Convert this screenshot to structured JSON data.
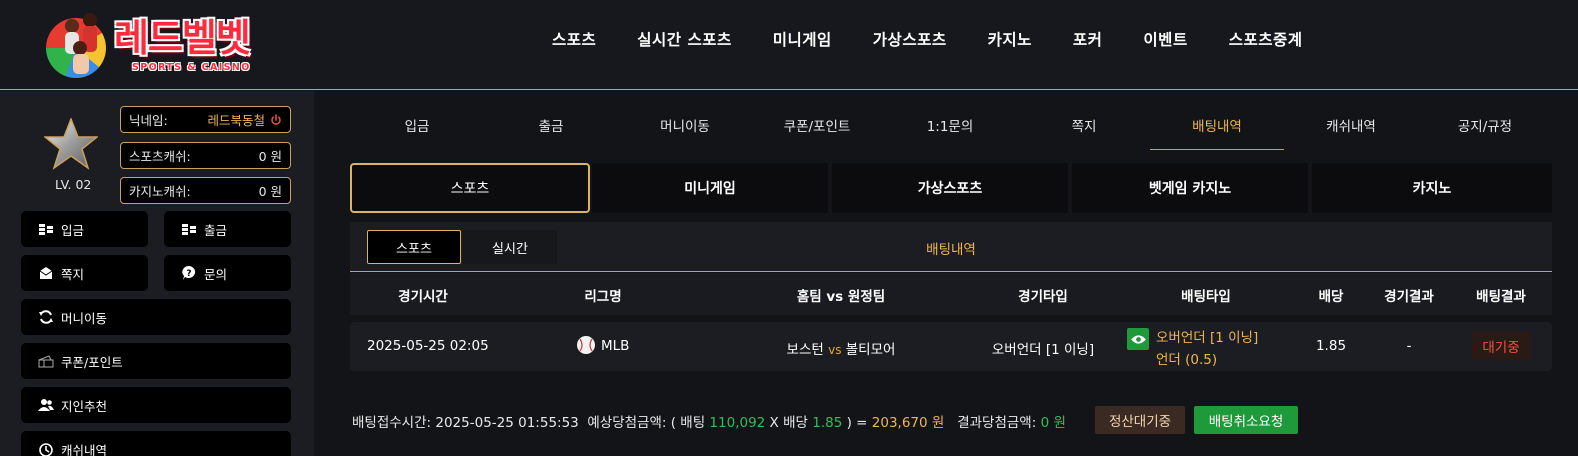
{
  "brand": {
    "name": "레드벨벳",
    "tagline": "SPORTS & CAISNO"
  },
  "topnav": [
    "스포츠",
    "실시간 스포츠",
    "미니게임",
    "가상스포츠",
    "카지노",
    "포커",
    "이벤트",
    "스포츠중계"
  ],
  "sidebar": {
    "level": "LV. 02",
    "nickname_label": "닉네임:",
    "nickname_value": "레드북동철",
    "sports_cash_label": "스포츠캐쉬:",
    "sports_cash_value": "0 원",
    "casino_cash_label": "카지노캐쉬:",
    "casino_cash_value": "0 원",
    "buttons": {
      "deposit": "입금",
      "withdraw": "출금",
      "message": "쪽지",
      "inquiry": "문의",
      "money_move": "머니이동",
      "coupon": "쿠폰/포인트",
      "referral": "지인추천",
      "cash_history": "캐쉬내역"
    }
  },
  "subnav": {
    "items": [
      "입금",
      "출금",
      "머니이동",
      "쿠폰/포인트",
      "1:1문의",
      "쪽지",
      "배팅내역",
      "캐쉬내역",
      "공지/규정"
    ],
    "active": "배팅내역"
  },
  "game_tabs": {
    "items": [
      "스포츠",
      "미니게임",
      "가상스포츠",
      "벳게임 카지노",
      "카지노"
    ],
    "active": "스포츠"
  },
  "inner_tabs": {
    "items": [
      "스포츠",
      "실시간"
    ],
    "active": "스포츠",
    "title": "배팅내역"
  },
  "table": {
    "headers": [
      "경기시간",
      "리그명",
      "홈팀 vs 원정팀",
      "경기타입",
      "배팅타입",
      "배당",
      "경기결과",
      "배팅결과"
    ],
    "rows": [
      {
        "time": "2025-05-25 02:05",
        "league": "MLB",
        "home": "보스턴",
        "vs": "vs",
        "away": "볼티모어",
        "game_type": "오버언더 [1 이닝]",
        "bet_type_line1": "오버언더 [1 이닝]",
        "bet_type_line2": "언더 (0.5)",
        "odds": "1.85",
        "game_result": "-",
        "bet_result": "대기중"
      }
    ]
  },
  "footer": {
    "received_label": "배팅접수시간:",
    "received_value": "2025-05-25 01:55:53",
    "expected_label": "예상당첨금액: ( 배팅",
    "bet_amount": "110,092",
    "x_label": "X 배당",
    "odds": "1.85",
    "equals": ") =",
    "expected_value": "203,670",
    "won_unit": "원",
    "result_label": "결과당첨금액:",
    "result_value": "0",
    "result_unit": "원",
    "settle_button": "정산대기중",
    "cancel_button": "배팅취소요청"
  },
  "colors": {
    "gold": "#c9a15c",
    "accent_text": "#f0b54f",
    "green": "#1f9a3a",
    "red_status": "#e9553f"
  }
}
